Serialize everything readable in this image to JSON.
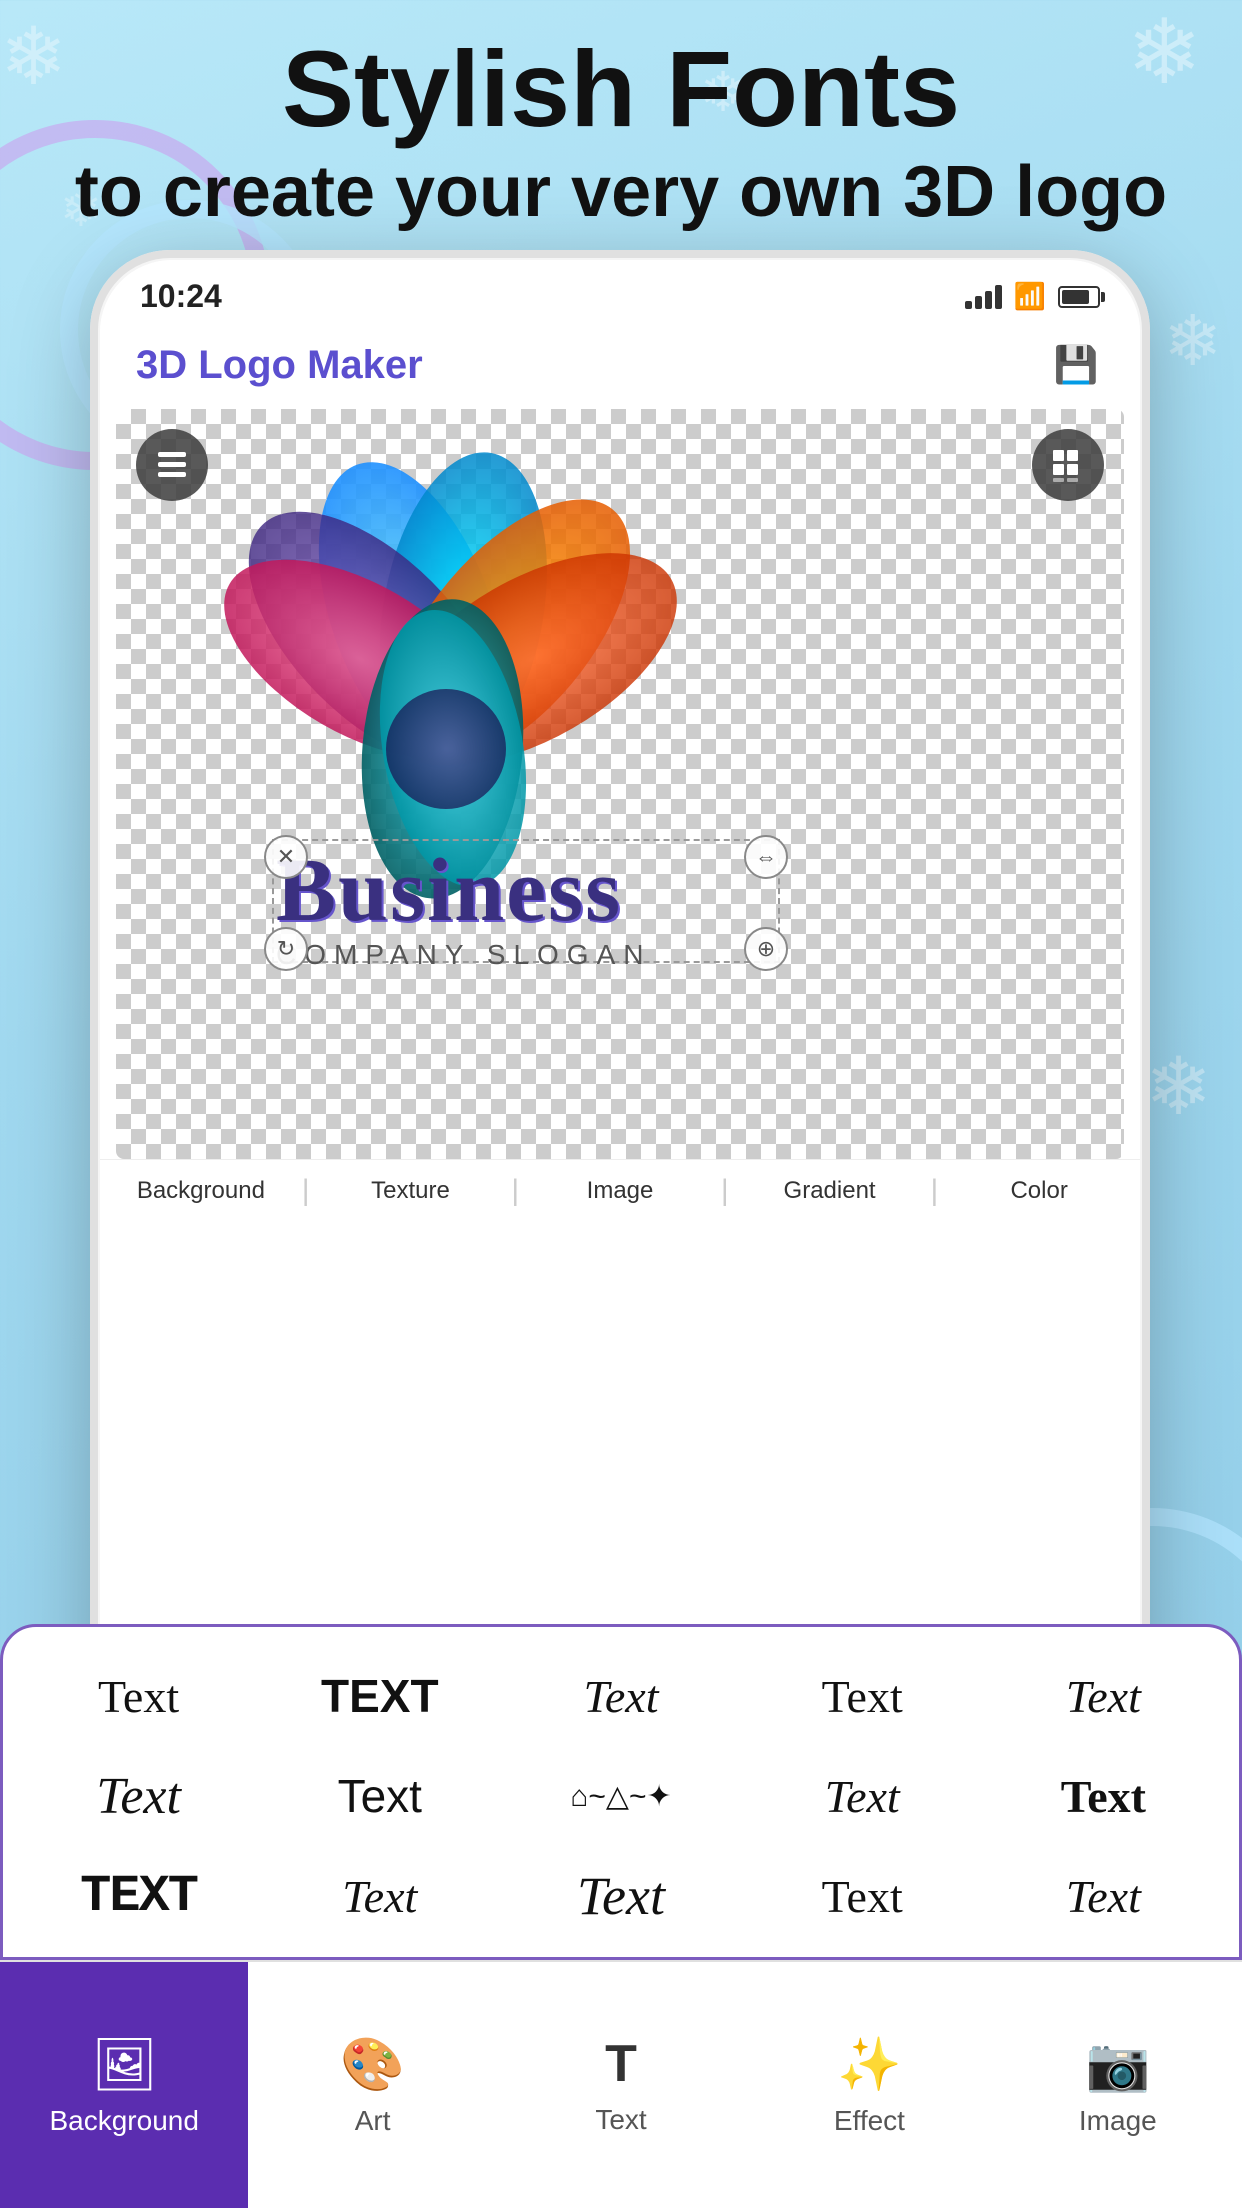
{
  "page": {
    "background_color": "#a8ddf0",
    "header": {
      "title": "Stylish Fonts",
      "subtitle": "to create your very own 3D logo"
    },
    "phone": {
      "status_bar": {
        "time": "10:24"
      },
      "app": {
        "title": "3D Logo Maker"
      },
      "canvas": {
        "business_text": "Business",
        "slogan_text": "COMPANY SLOGAN"
      },
      "background_tabs": [
        "Background",
        "Texture",
        "Image",
        "Gradient",
        "Color"
      ],
      "font_grid": [
        {
          "label": "Text",
          "class": "f0"
        },
        {
          "label": "TEXT",
          "class": "f1"
        },
        {
          "label": "Text",
          "class": "f2"
        },
        {
          "label": "Text",
          "class": "f3"
        },
        {
          "label": "Text",
          "class": "f4"
        },
        {
          "label": "Text",
          "class": "f5"
        },
        {
          "label": "Text",
          "class": "f6"
        },
        {
          "label": "⌂~△~",
          "class": "f7"
        },
        {
          "label": "Text",
          "class": "f8"
        },
        {
          "label": "Text",
          "class": "f9"
        },
        {
          "label": "TEXT",
          "class": "f10"
        },
        {
          "label": "Text",
          "class": "f11"
        },
        {
          "label": "Text",
          "class": "f12"
        },
        {
          "label": "Text",
          "class": "f13"
        },
        {
          "label": "Text",
          "class": "f14"
        }
      ],
      "nav_items": [
        {
          "label": "Background",
          "icon": "🖼",
          "active": true
        },
        {
          "label": "Art",
          "icon": "🎨"
        },
        {
          "label": "Text",
          "icon": "T"
        },
        {
          "label": "Effect",
          "icon": "✨"
        },
        {
          "label": "Image",
          "icon": "📷"
        }
      ]
    }
  }
}
